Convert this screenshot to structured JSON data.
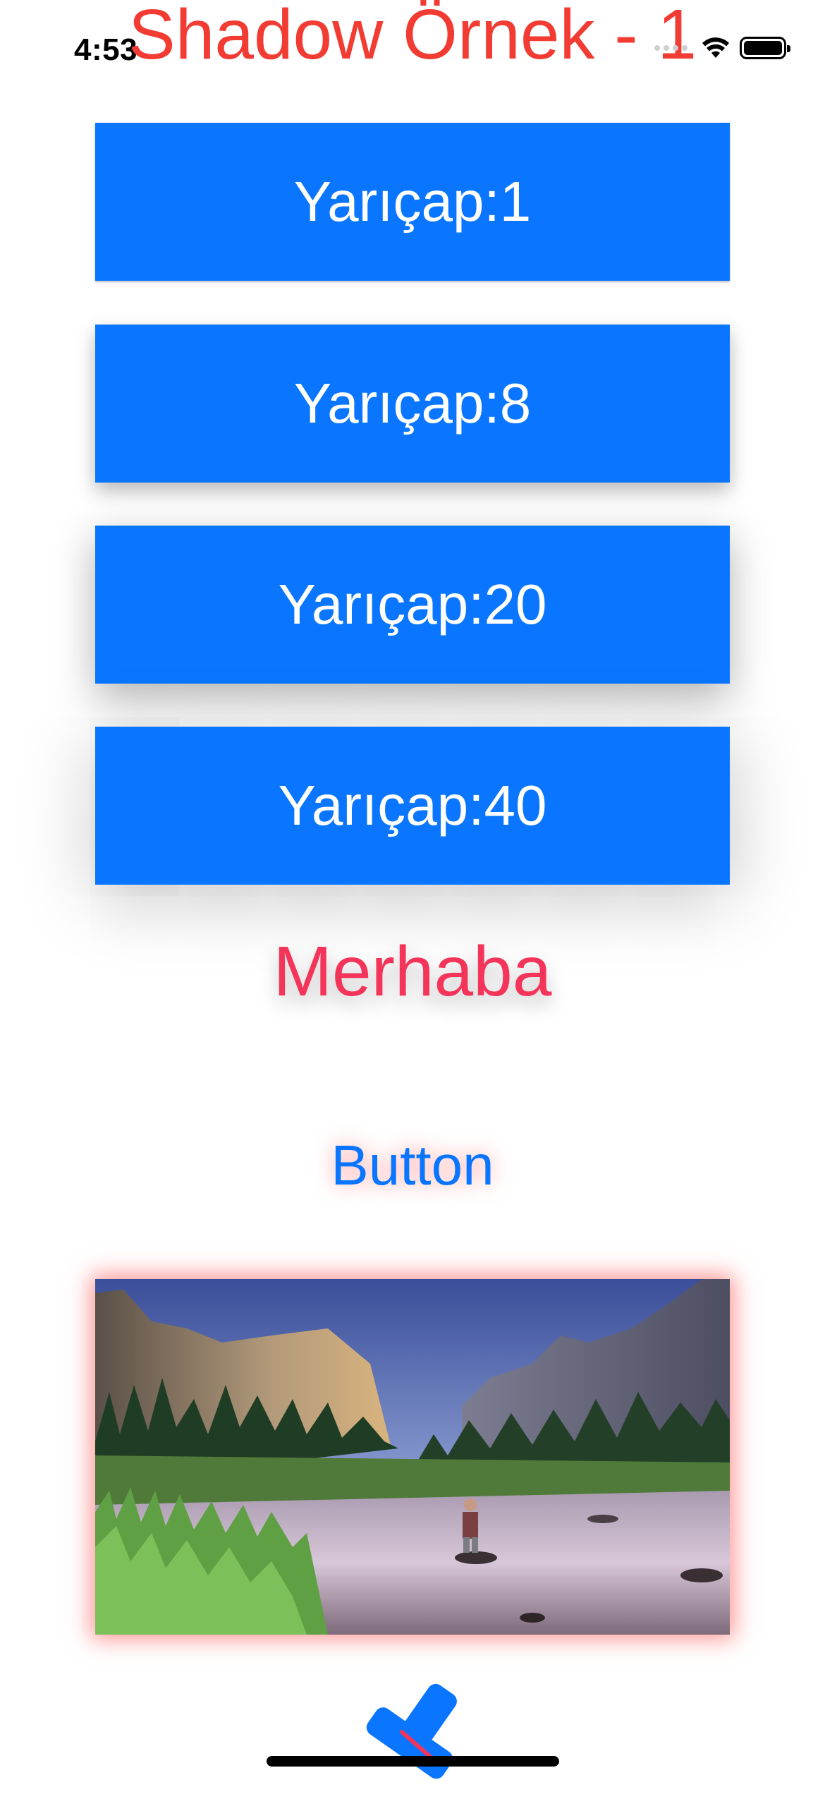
{
  "status_bar": {
    "time": "4:53"
  },
  "title": "Shadow Örnek - 1",
  "buttons": [
    {
      "label": "Yarıçap:1"
    },
    {
      "label": "Yarıçap:8"
    },
    {
      "label": "Yarıçap:20"
    },
    {
      "label": "Yarıçap:40"
    }
  ],
  "hello_label": "Merhaba",
  "text_button": "Button",
  "icons": {
    "wifi": "wifi-icon",
    "battery": "battery-icon",
    "signal": "signal-icon",
    "logo": "app-logo-icon"
  },
  "colors": {
    "title": "#f23c33",
    "button_bg": "#0a76ff",
    "button_text": "#ffffff",
    "hello": "#f5345a",
    "text_button": "#0a76ff",
    "image_shadow": "#ff3c3c"
  }
}
